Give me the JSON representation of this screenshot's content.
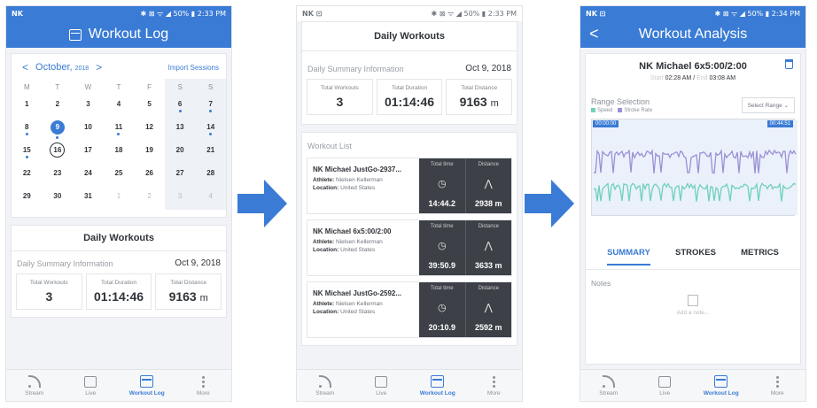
{
  "colors": {
    "accent": "#3a7bd5",
    "dark_tile": "#3d4147",
    "speed": "#6fd1b8",
    "stroke_rate": "#9b8fd6"
  },
  "screen1": {
    "status": {
      "left": "NK",
      "right": "✱ ⊠ ᯤ ◢ 50% ▮ 2:33 PM"
    },
    "title": "Workout Log",
    "calendar": {
      "prev": "<",
      "month": "October,",
      "year": "2018",
      "next": ">",
      "import_label": "Import Sessions",
      "weekdays": [
        "M",
        "T",
        "W",
        "T",
        "F",
        "S",
        "S"
      ],
      "days": [
        {
          "n": "1",
          "dot": false
        },
        {
          "n": "2",
          "dot": false
        },
        {
          "n": "3",
          "dot": false
        },
        {
          "n": "4",
          "dot": false
        },
        {
          "n": "5",
          "dot": false
        },
        {
          "n": "6",
          "dot": true
        },
        {
          "n": "7",
          "dot": true
        },
        {
          "n": "8",
          "dot": true
        },
        {
          "n": "9",
          "dot": true,
          "state": "sel"
        },
        {
          "n": "10",
          "dot": false
        },
        {
          "n": "11",
          "dot": true
        },
        {
          "n": "12",
          "dot": false
        },
        {
          "n": "13",
          "dot": false
        },
        {
          "n": "14",
          "dot": true
        },
        {
          "n": "15",
          "dot": true
        },
        {
          "n": "16",
          "dot": false,
          "state": "today"
        },
        {
          "n": "17",
          "dot": false
        },
        {
          "n": "18",
          "dot": false
        },
        {
          "n": "19",
          "dot": false
        },
        {
          "n": "20",
          "dot": false
        },
        {
          "n": "21",
          "dot": false
        },
        {
          "n": "22",
          "dot": false
        },
        {
          "n": "23",
          "dot": false
        },
        {
          "n": "24",
          "dot": false
        },
        {
          "n": "25",
          "dot": false
        },
        {
          "n": "26",
          "dot": false
        },
        {
          "n": "27",
          "dot": false
        },
        {
          "n": "28",
          "dot": false
        },
        {
          "n": "29",
          "dot": false
        },
        {
          "n": "30",
          "dot": false
        },
        {
          "n": "31",
          "dot": false
        },
        {
          "n": "1",
          "dot": false,
          "muted": true
        },
        {
          "n": "2",
          "dot": false,
          "muted": true
        },
        {
          "n": "3",
          "dot": false,
          "muted": true
        },
        {
          "n": "4",
          "dot": false,
          "muted": true
        }
      ]
    },
    "daily": {
      "title": "Daily Workouts",
      "summary_label": "Daily Summary Information",
      "date": "Oct 9, 2018",
      "total_workouts_label": "Total Workouts",
      "total_workouts": "3",
      "total_duration_label": "Total Duration",
      "total_duration": "01:14:46",
      "total_distance_label": "Total Distance",
      "total_distance": "9163",
      "distance_unit": "m"
    }
  },
  "screen2": {
    "status": {
      "left": "NK ⊡",
      "right": "✱ ⊠ ᯤ ◢ 50% ▮ 2:33 PM"
    },
    "title": "Daily Workouts",
    "summary_label": "Daily Summary Information",
    "date": "Oct 9, 2018",
    "total_workouts_label": "Total Workouts",
    "total_workouts": "3",
    "total_duration_label": "Total Duration",
    "total_duration": "01:14:46",
    "total_distance_label": "Total Distance",
    "total_distance": "9163",
    "distance_unit": "m",
    "list_label": "Workout List",
    "workouts": [
      {
        "name": "NK Michael JustGo-2937...",
        "athlete_label": "Athlete:",
        "athlete": "Nielsen Kellerman",
        "location_label": "Location:",
        "location": "United States",
        "time_label": "Total time",
        "time": "14:44.2",
        "dist_label": "Distance",
        "dist": "2938 m"
      },
      {
        "name": "NK Michael 6x5:00/2:00",
        "athlete_label": "Athlete:",
        "athlete": "Nielsen Kellerman",
        "location_label": "Location:",
        "location": "United States",
        "time_label": "Total time",
        "time": "39:50.9",
        "dist_label": "Distance",
        "dist": "3633 m"
      },
      {
        "name": "NK Michael JustGo-2592...",
        "athlete_label": "Athlete:",
        "athlete": "Nielsen Kellerman",
        "location_label": "Location:",
        "location": "United States",
        "time_label": "Total time",
        "time": "20:10.9",
        "dist_label": "Distance",
        "dist": "2592 m"
      }
    ]
  },
  "screen3": {
    "status": {
      "left": "NK ⊡",
      "right": "✱ ⊠ ᯤ ◢ 50% ▮ 2:34 PM"
    },
    "back": "<",
    "title": "Workout Analysis",
    "workout_name": "NK Michael 6x5:00/2:00",
    "start_label": "Start",
    "start": "02:28 AM",
    "sep": "/",
    "end_label": "End",
    "end": "03:08 AM",
    "range_title": "Range Selection",
    "legend_speed": "Speed",
    "legend_stroke": "Stroke Rate",
    "select_label": "Select Range",
    "range_start": "00:00:00",
    "range_end": "00:44:51",
    "tabs": [
      "SUMMARY",
      "STROKES",
      "METRICS"
    ],
    "notes_label": "Notes",
    "add_note": "Add a note..."
  },
  "nav": [
    {
      "label": "Stream",
      "icon": "stream-icon"
    },
    {
      "label": "Live",
      "icon": "live-icon"
    },
    {
      "label": "Workout Log",
      "icon": "workout-log-icon"
    },
    {
      "label": "More",
      "icon": "more-icon"
    }
  ]
}
